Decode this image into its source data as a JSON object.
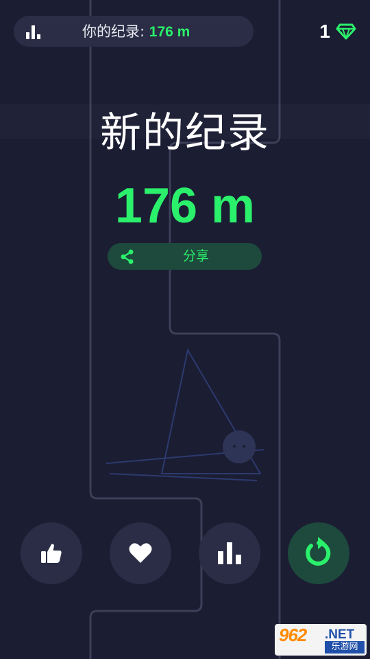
{
  "header": {
    "record_label": "你的纪录: ",
    "record_value": "176 m",
    "gem_count": "1"
  },
  "result": {
    "headline": "新的纪录",
    "score": "176 m",
    "share_label": "分享"
  },
  "actions": [
    {
      "name": "like",
      "icon": "thumbs-up-icon"
    },
    {
      "name": "favorite",
      "icon": "heart-icon"
    },
    {
      "name": "leaderboard",
      "icon": "bar-chart-icon"
    },
    {
      "name": "restart",
      "icon": "restart-icon"
    }
  ],
  "watermark": {
    "main": "962",
    "net": ".NET",
    "sub": "乐游网"
  },
  "colors": {
    "background": "#1b1d33",
    "panel": "#2a2d45",
    "accent_green": "#2bf06b",
    "green_panel": "#1d4a3c"
  }
}
